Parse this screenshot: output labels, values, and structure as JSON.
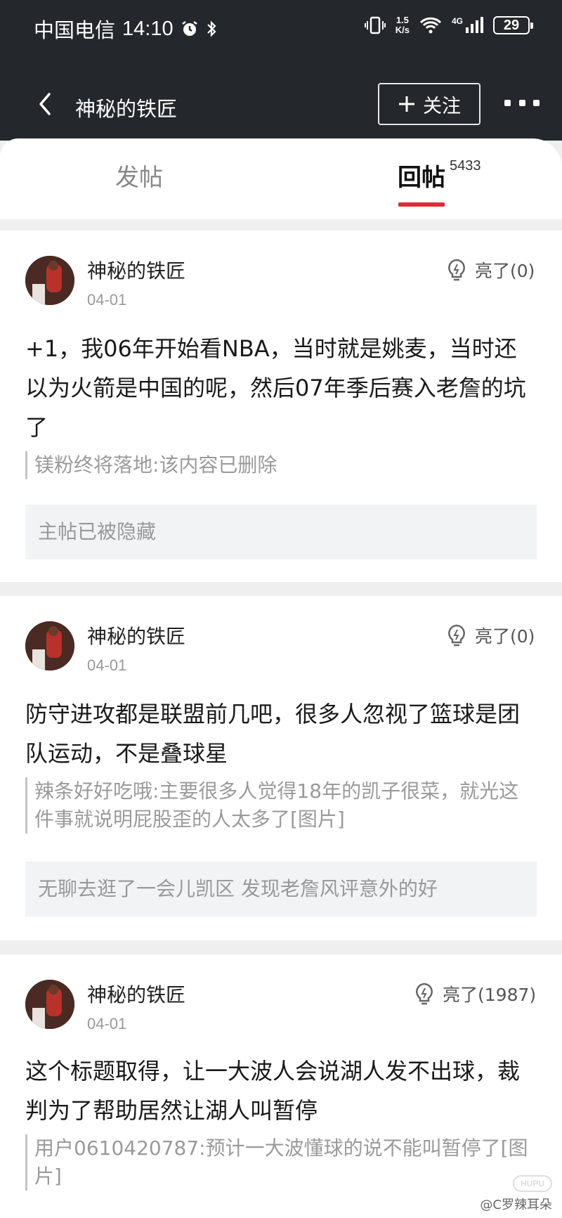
{
  "status_bar": {
    "carrier": "中国电信",
    "time": "14:10",
    "speed_value": "1.5",
    "speed_unit": "K/s",
    "network": "4G",
    "battery": "29"
  },
  "nav": {
    "title": "神秘的铁匠",
    "follow_label": "关注"
  },
  "tabs": [
    {
      "label": "发帖"
    },
    {
      "label": "回帖",
      "count": "5433"
    }
  ],
  "posts": [
    {
      "author": "神秘的铁匠",
      "date": "04-01",
      "likes": "亮了(0)",
      "text": "+1，我06年开始看NBA，当时就是姚麦，当时还以为火箭是中国的呢，然后07年季后赛入老詹的坑了",
      "quote": "镁粉终将落地:该内容已删除",
      "origin": "主帖已被隐藏"
    },
    {
      "author": "神秘的铁匠",
      "date": "04-01",
      "likes": "亮了(0)",
      "text": "防守进攻都是联盟前几吧，很多人忽视了篮球是团队运动，不是叠球星",
      "quote": "辣条好好吃哦:主要很多人觉得18年的凯子很菜，就光这件事就说明屁股歪的人太多了[图片]",
      "origin": "无聊去逛了一会儿凯区 发现老詹风评意外的好"
    },
    {
      "author": "神秘的铁匠",
      "date": "04-01",
      "likes": "亮了(1987)",
      "text": "这个标题取得，让一大波人会说湖人发不出球，裁判为了帮助居然让湖人叫暂停",
      "quote": "用户0610420787:预计一大波懂球的说不能叫暂停了[图片]"
    }
  ],
  "watermark": {
    "logo": "HUPU",
    "text": "@C罗辣耳朵"
  },
  "colors": {
    "header_bg": "#24272c",
    "accent": "#dc2b37",
    "page_bg": "#efefef"
  }
}
